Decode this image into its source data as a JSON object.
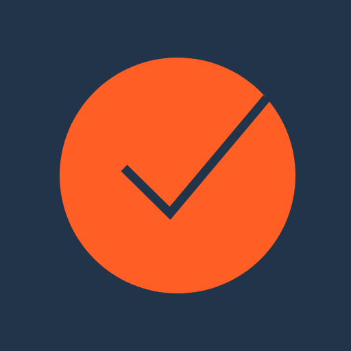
{
  "icon": {
    "name": "checkmark-circle-icon",
    "colors": {
      "background": "#21344a",
      "circle": "#ff5e25",
      "check": "#21344a"
    }
  }
}
